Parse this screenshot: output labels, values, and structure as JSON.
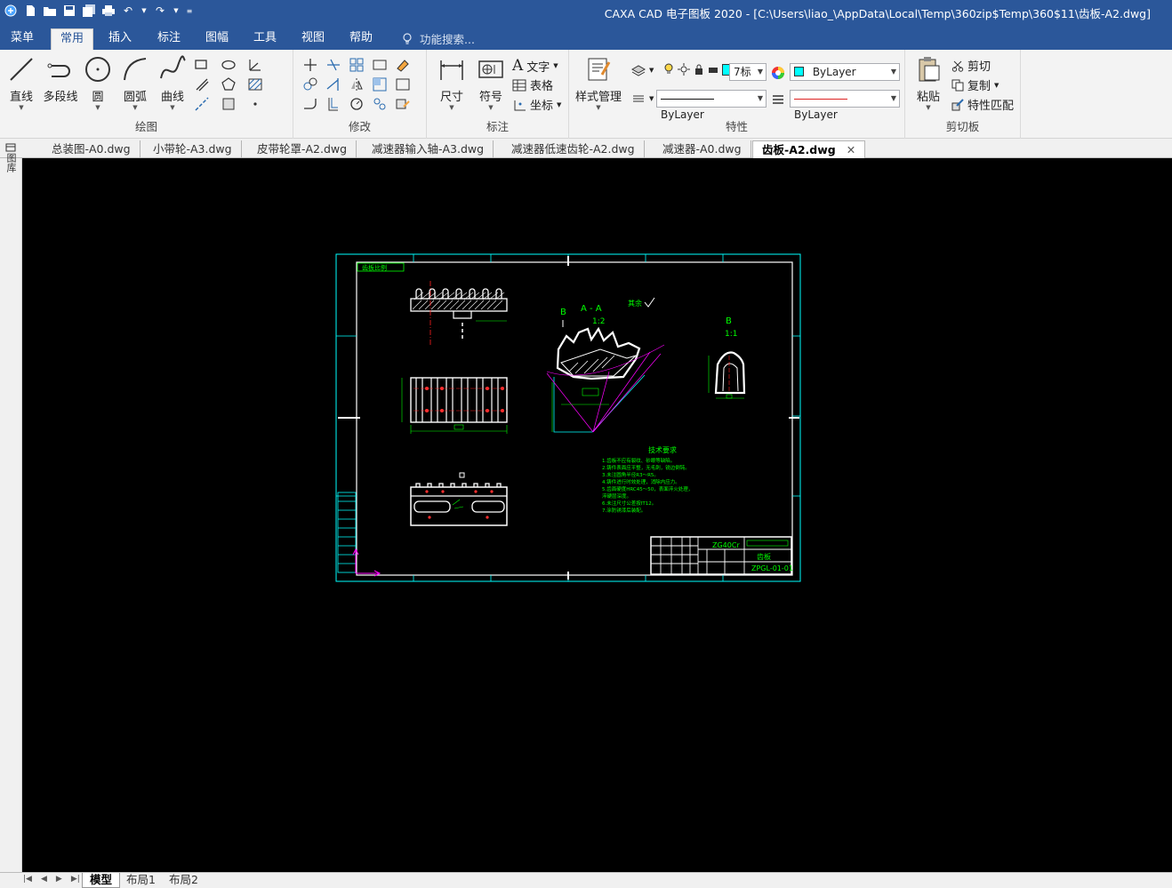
{
  "window": {
    "title": "CAXA CAD 电子图板 2020 - [C:\\Users\\liao_\\AppData\\Local\\Temp\\360zip$Temp\\360$11\\齿板-A2.dwg]"
  },
  "menu": {
    "tabs": [
      "菜单",
      "常用",
      "插入",
      "标注",
      "图幅",
      "工具",
      "视图",
      "帮助"
    ],
    "active": "常用",
    "search_placeholder": "功能搜索..."
  },
  "ribbon": {
    "draw": {
      "label": "绘图",
      "line": "直线",
      "polyline": "多段线",
      "circle": "圆",
      "arc": "圆弧",
      "curve": "曲线"
    },
    "modify": {
      "label": "修改"
    },
    "annotate": {
      "label": "标注",
      "dimension": "尺寸",
      "symbol": "符号",
      "text": "文字",
      "table": "表格",
      "coord": "坐标"
    },
    "properties": {
      "label": "特性",
      "style_manager": "样式管理",
      "text_style": "7标",
      "color_combo": "ByLayer",
      "linetype_combo": "ByLayer",
      "lineweight_combo": "ByLayer"
    },
    "clipboard": {
      "label": "剪切板",
      "paste": "粘贴",
      "cut": "剪切",
      "copy": "复制",
      "match": "特性匹配"
    }
  },
  "doc_tabs": [
    "总装图-A0.dwg",
    "小带轮-A3.dwg",
    "皮带轮罩-A2.dwg",
    "减速器输入轴-A3.dwg",
    "减速器低速齿轮-A2.dwg",
    "减速器-A0.dwg",
    "齿板-A2.dwg"
  ],
  "active_doc": "齿板-A2.dwg",
  "side_panel": {
    "label": "图库"
  },
  "drawing": {
    "corner_label": "齿板比例",
    "section_title": "A - A",
    "section_scale": "1:2",
    "detail_b": "B",
    "detail_b_scale": "1:1",
    "marker_b": "B",
    "rough_label": "其余",
    "tech_title": "技术要求",
    "tech_lines": [
      "1.齿板不应有裂纹、砂眼等缺陷。",
      "2.铸件表面应平整，无毛刺，锐边倒钝。",
      "3.未注圆角半径R3～R5。",
      "4.铸件进行时效处理，消除内应力。",
      "5.齿面硬度HRC45～50，表面淬火处理，",
      "  淬硬层深度。",
      "6.未注尺寸公差按IT12。",
      "7.涂防锈漆后装配。"
    ],
    "material": "ZG40Cr",
    "part_name": "齿板",
    "drawing_no": "ZPGL-01-01"
  },
  "layout_tabs": [
    "模型",
    "布局1",
    "布局2"
  ],
  "active_layout": "模型"
}
